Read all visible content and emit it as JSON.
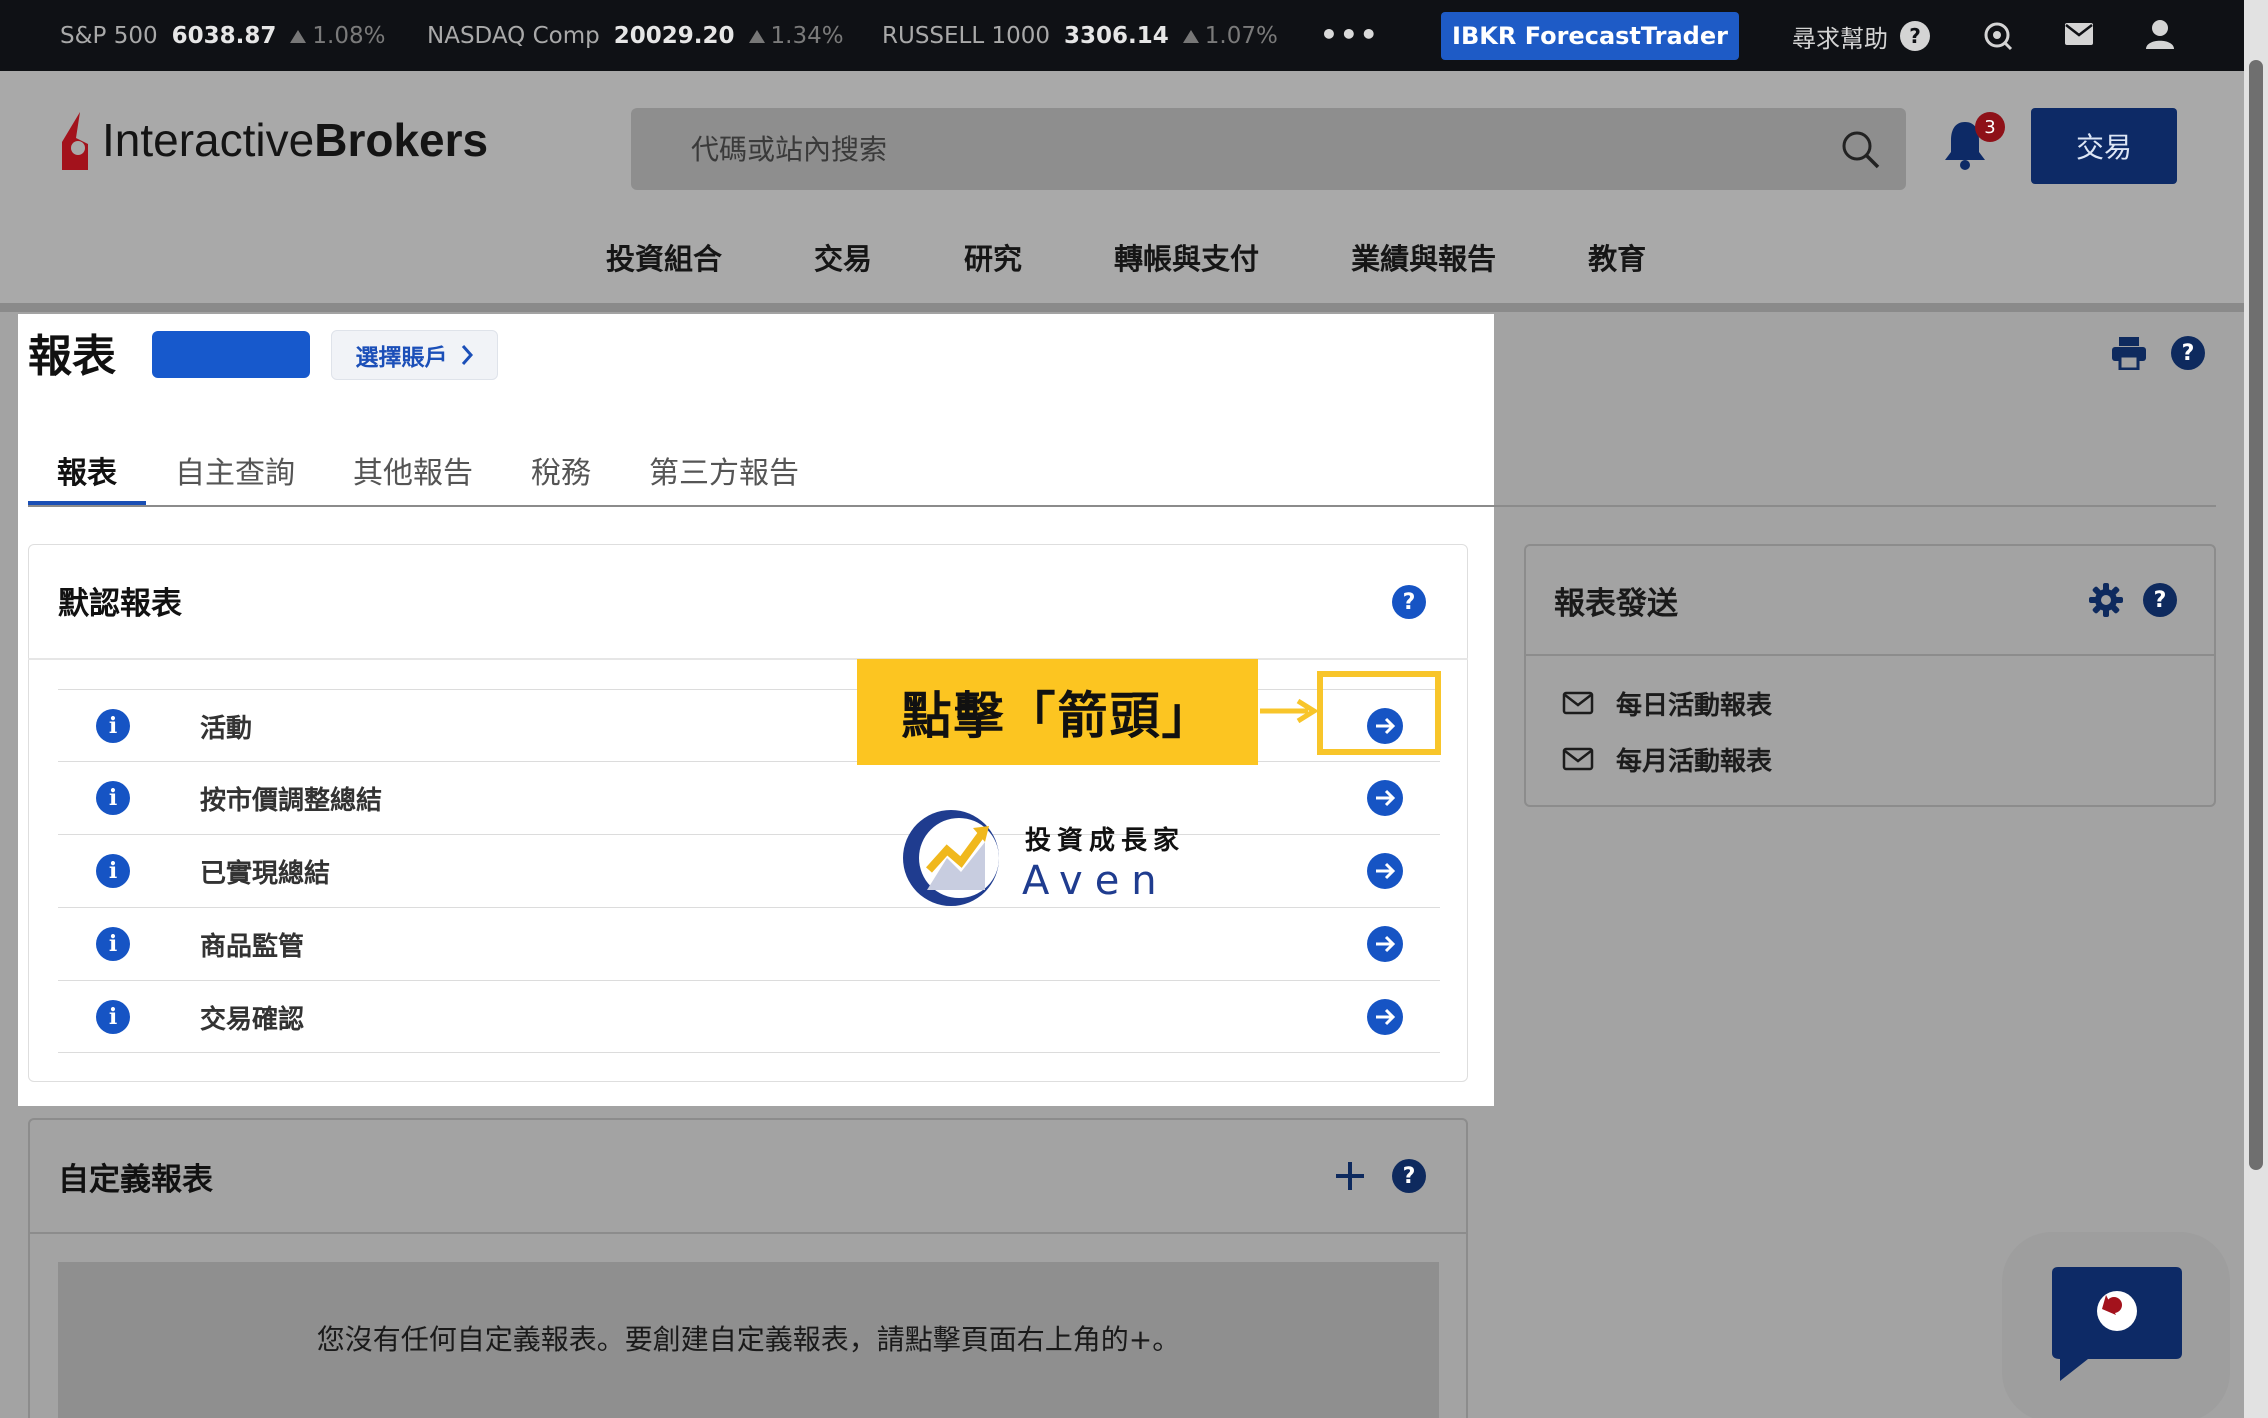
{
  "ticker": [
    {
      "name": "S&P 500",
      "value": "6038.87",
      "change": "1.08%"
    },
    {
      "name": "NASDAQ Comp",
      "value": "20029.20",
      "change": "1.34%"
    },
    {
      "name": "RUSSELL 1000",
      "value": "3306.14",
      "change": "1.07%"
    }
  ],
  "topbar": {
    "more": "•••",
    "forecast_label": "IBKR ForecastTrader",
    "help_label": "尋求幫助",
    "help_icon": "?"
  },
  "brand": {
    "logo_regular": "Interactive",
    "logo_bold": "Brokers"
  },
  "search": {
    "placeholder": "代碼或站內搜索"
  },
  "notifications": {
    "count": "3"
  },
  "trade_button": "交易",
  "nav": [
    "投資組合",
    "交易",
    "研究",
    "轉帳與支付",
    "業績與報告",
    "教育"
  ],
  "page": {
    "title": "報表",
    "select_account": "選擇賬戶"
  },
  "tabs": [
    "報表",
    "自主查詢",
    "其他報告",
    "稅務",
    "第三方報告"
  ],
  "default_reports": {
    "title": "默認報表",
    "rows": [
      "活動",
      "按市價調整總結",
      "已實現總結",
      "商品監管",
      "交易確認"
    ]
  },
  "annotation": {
    "callout": "點擊「箭頭」"
  },
  "watermark": {
    "line1": "投資成長家",
    "line2": "Aven"
  },
  "delivery": {
    "title": "報表發送",
    "items": [
      "每日活動報表",
      "每月活動報表"
    ]
  },
  "custom_reports": {
    "title": "自定義報表",
    "empty_text": "您沒有任何自定義報表。要創建自定義報表，請點擊頁面右上角的+。"
  },
  "colors": {
    "accent": "#1654c4",
    "navy": "#0d2a66",
    "highlight": "#fcc521",
    "badge": "#8e1118"
  }
}
